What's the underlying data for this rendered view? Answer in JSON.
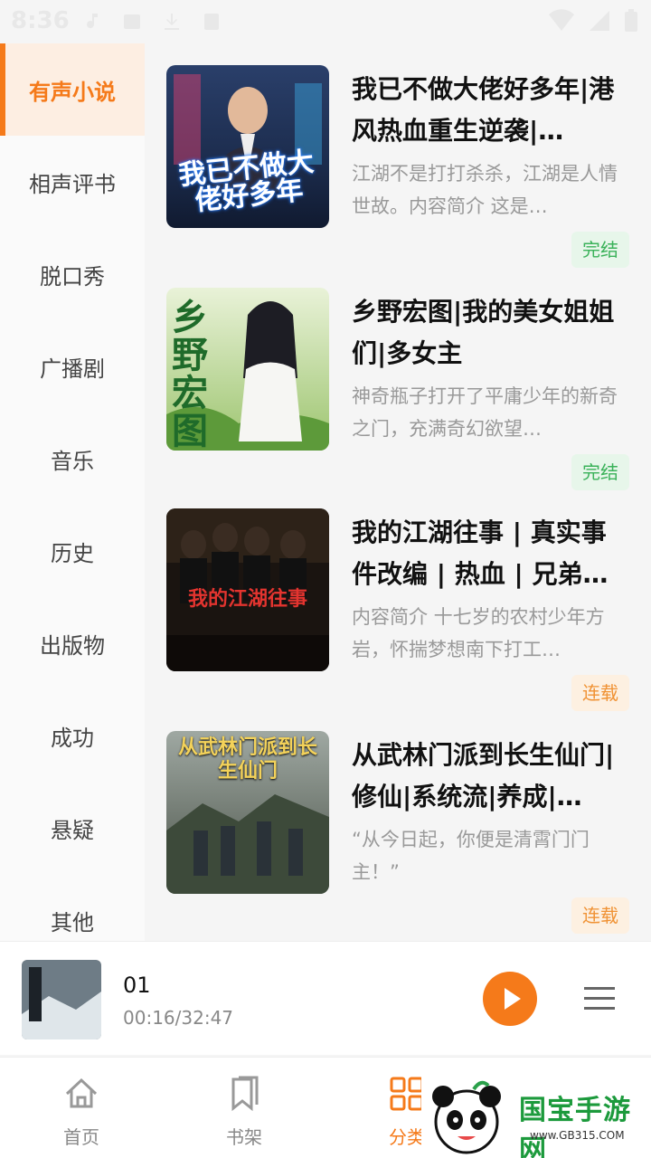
{
  "status_bar": {
    "time": "8:36"
  },
  "sidebar": {
    "items": [
      {
        "label": "有声小说",
        "active": true
      },
      {
        "label": "相声评书"
      },
      {
        "label": "脱口秀"
      },
      {
        "label": "广播剧"
      },
      {
        "label": "音乐"
      },
      {
        "label": "历史"
      },
      {
        "label": "出版物"
      },
      {
        "label": "成功"
      },
      {
        "label": "悬疑"
      },
      {
        "label": "其他"
      }
    ]
  },
  "books": [
    {
      "title": "我已不做大佬好多年|港风热血重生逆袭|…",
      "cover_text": "我已不做大佬好多年",
      "description": "江湖不是打打杀杀，江湖是人情世故。内容简介 这是…",
      "status": "完结",
      "status_color": "#3bb25a"
    },
    {
      "title": "乡野宏图|我的美女姐姐们|多女主",
      "cover_text": "乡野宏图",
      "description": "神奇瓶子打开了平庸少年的新奇之门，充满奇幻欲望…",
      "status": "完结",
      "status_color": "#3bb25a"
    },
    {
      "title": "我的江湖往事 | 真实事件改编 | 热血 | 兄弟…",
      "cover_text": "我的江湖往事",
      "description": "内容简介 十七岁的农村少年方岩，怀揣梦想南下打工…",
      "status": "连载",
      "status_color": "#f09234"
    },
    {
      "title": "从武林门派到长生仙门|修仙|系统流|养成|…",
      "cover_text": "从武林门派到长生仙门",
      "description": "“从今日起，你便是清霄门门主！”",
      "status": "连载",
      "status_color": "#f09234"
    }
  ],
  "player": {
    "title": "01",
    "time": "00:16/32:47"
  },
  "bottom_nav": {
    "items": [
      {
        "label": "首页"
      },
      {
        "label": "书架"
      },
      {
        "label": "分类",
        "active": true
      }
    ]
  },
  "watermark": {
    "text": "国宝手游网",
    "url": "www.GB315.COM"
  },
  "colors": {
    "accent": "#f57a1a",
    "done": "#3bb25a",
    "serial": "#f09234"
  }
}
